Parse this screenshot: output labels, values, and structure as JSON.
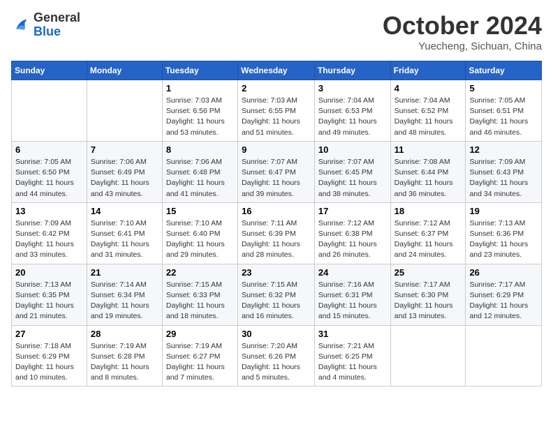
{
  "header": {
    "logo_general": "General",
    "logo_blue": "Blue",
    "month_title": "October 2024",
    "location": "Yuecheng, Sichuan, China"
  },
  "weekdays": [
    "Sunday",
    "Monday",
    "Tuesday",
    "Wednesday",
    "Thursday",
    "Friday",
    "Saturday"
  ],
  "weeks": [
    [
      {
        "day": "",
        "info": ""
      },
      {
        "day": "",
        "info": ""
      },
      {
        "day": "1",
        "info": "Sunrise: 7:03 AM\nSunset: 6:56 PM\nDaylight: 11 hours and 53 minutes."
      },
      {
        "day": "2",
        "info": "Sunrise: 7:03 AM\nSunset: 6:55 PM\nDaylight: 11 hours and 51 minutes."
      },
      {
        "day": "3",
        "info": "Sunrise: 7:04 AM\nSunset: 6:53 PM\nDaylight: 11 hours and 49 minutes."
      },
      {
        "day": "4",
        "info": "Sunrise: 7:04 AM\nSunset: 6:52 PM\nDaylight: 11 hours and 48 minutes."
      },
      {
        "day": "5",
        "info": "Sunrise: 7:05 AM\nSunset: 6:51 PM\nDaylight: 11 hours and 46 minutes."
      }
    ],
    [
      {
        "day": "6",
        "info": "Sunrise: 7:05 AM\nSunset: 6:50 PM\nDaylight: 11 hours and 44 minutes."
      },
      {
        "day": "7",
        "info": "Sunrise: 7:06 AM\nSunset: 6:49 PM\nDaylight: 11 hours and 43 minutes."
      },
      {
        "day": "8",
        "info": "Sunrise: 7:06 AM\nSunset: 6:48 PM\nDaylight: 11 hours and 41 minutes."
      },
      {
        "day": "9",
        "info": "Sunrise: 7:07 AM\nSunset: 6:47 PM\nDaylight: 11 hours and 39 minutes."
      },
      {
        "day": "10",
        "info": "Sunrise: 7:07 AM\nSunset: 6:45 PM\nDaylight: 11 hours and 38 minutes."
      },
      {
        "day": "11",
        "info": "Sunrise: 7:08 AM\nSunset: 6:44 PM\nDaylight: 11 hours and 36 minutes."
      },
      {
        "day": "12",
        "info": "Sunrise: 7:09 AM\nSunset: 6:43 PM\nDaylight: 11 hours and 34 minutes."
      }
    ],
    [
      {
        "day": "13",
        "info": "Sunrise: 7:09 AM\nSunset: 6:42 PM\nDaylight: 11 hours and 33 minutes."
      },
      {
        "day": "14",
        "info": "Sunrise: 7:10 AM\nSunset: 6:41 PM\nDaylight: 11 hours and 31 minutes."
      },
      {
        "day": "15",
        "info": "Sunrise: 7:10 AM\nSunset: 6:40 PM\nDaylight: 11 hours and 29 minutes."
      },
      {
        "day": "16",
        "info": "Sunrise: 7:11 AM\nSunset: 6:39 PM\nDaylight: 11 hours and 28 minutes."
      },
      {
        "day": "17",
        "info": "Sunrise: 7:12 AM\nSunset: 6:38 PM\nDaylight: 11 hours and 26 minutes."
      },
      {
        "day": "18",
        "info": "Sunrise: 7:12 AM\nSunset: 6:37 PM\nDaylight: 11 hours and 24 minutes."
      },
      {
        "day": "19",
        "info": "Sunrise: 7:13 AM\nSunset: 6:36 PM\nDaylight: 11 hours and 23 minutes."
      }
    ],
    [
      {
        "day": "20",
        "info": "Sunrise: 7:13 AM\nSunset: 6:35 PM\nDaylight: 11 hours and 21 minutes."
      },
      {
        "day": "21",
        "info": "Sunrise: 7:14 AM\nSunset: 6:34 PM\nDaylight: 11 hours and 19 minutes."
      },
      {
        "day": "22",
        "info": "Sunrise: 7:15 AM\nSunset: 6:33 PM\nDaylight: 11 hours and 18 minutes."
      },
      {
        "day": "23",
        "info": "Sunrise: 7:15 AM\nSunset: 6:32 PM\nDaylight: 11 hours and 16 minutes."
      },
      {
        "day": "24",
        "info": "Sunrise: 7:16 AM\nSunset: 6:31 PM\nDaylight: 11 hours and 15 minutes."
      },
      {
        "day": "25",
        "info": "Sunrise: 7:17 AM\nSunset: 6:30 PM\nDaylight: 11 hours and 13 minutes."
      },
      {
        "day": "26",
        "info": "Sunrise: 7:17 AM\nSunset: 6:29 PM\nDaylight: 11 hours and 12 minutes."
      }
    ],
    [
      {
        "day": "27",
        "info": "Sunrise: 7:18 AM\nSunset: 6:29 PM\nDaylight: 11 hours and 10 minutes."
      },
      {
        "day": "28",
        "info": "Sunrise: 7:19 AM\nSunset: 6:28 PM\nDaylight: 11 hours and 8 minutes."
      },
      {
        "day": "29",
        "info": "Sunrise: 7:19 AM\nSunset: 6:27 PM\nDaylight: 11 hours and 7 minutes."
      },
      {
        "day": "30",
        "info": "Sunrise: 7:20 AM\nSunset: 6:26 PM\nDaylight: 11 hours and 5 minutes."
      },
      {
        "day": "31",
        "info": "Sunrise: 7:21 AM\nSunset: 6:25 PM\nDaylight: 11 hours and 4 minutes."
      },
      {
        "day": "",
        "info": ""
      },
      {
        "day": "",
        "info": ""
      }
    ]
  ]
}
